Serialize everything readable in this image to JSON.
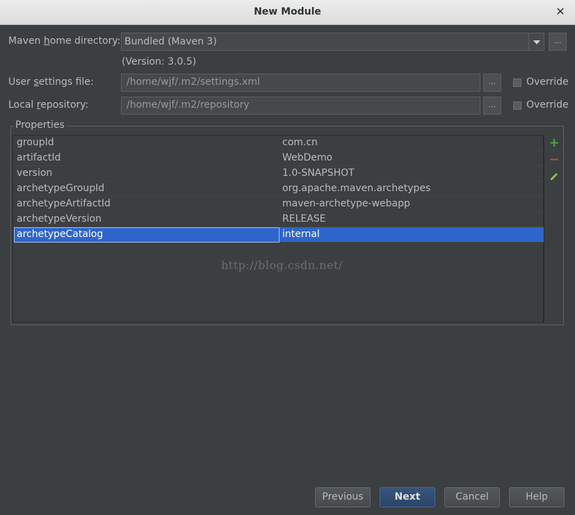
{
  "window": {
    "title": "New Module"
  },
  "maven_home": {
    "label_pre": "Maven ",
    "label_mnemonic": "h",
    "label_post": "ome directory:",
    "value": "Bundled (Maven 3)",
    "version_note": "(Version: 3.0.5)",
    "browse_label": "..."
  },
  "user_settings": {
    "label_pre": "User ",
    "label_mnemonic": "s",
    "label_post": "ettings file:",
    "value": "/home/wjf/.m2/settings.xml",
    "browse_label": "...",
    "override_label": "Override"
  },
  "local_repo": {
    "label_pre": "Local ",
    "label_mnemonic": "r",
    "label_post": "epository:",
    "value": "/home/wjf/.m2/repository",
    "browse_label": "...",
    "override_label": "Override"
  },
  "properties": {
    "title": "Properties",
    "rows": [
      {
        "key": "groupId",
        "value": "com.cn"
      },
      {
        "key": "artifactId",
        "value": "WebDemo"
      },
      {
        "key": "version",
        "value": "1.0-SNAPSHOT"
      },
      {
        "key": "archetypeGroupId",
        "value": "org.apache.maven.archetypes"
      },
      {
        "key": "archetypeArtifactId",
        "value": "maven-archetype-webapp"
      },
      {
        "key": "archetypeVersion",
        "value": "RELEASE"
      },
      {
        "key": "archetypeCatalog",
        "value": "internal"
      }
    ],
    "selected_row": 6,
    "toolbar": {
      "add_icon": "plus-icon",
      "remove_icon": "minus-icon",
      "edit_icon": "pencil-icon"
    }
  },
  "watermark": "http://blog.csdn.net/",
  "buttons": {
    "previous": "Previous",
    "next": "Next",
    "cancel": "Cancel",
    "help": "Help"
  },
  "colors": {
    "selection": "#2f65ca",
    "add": "#4aa83e",
    "remove": "#c9453d",
    "edit": "#8bc34a"
  }
}
